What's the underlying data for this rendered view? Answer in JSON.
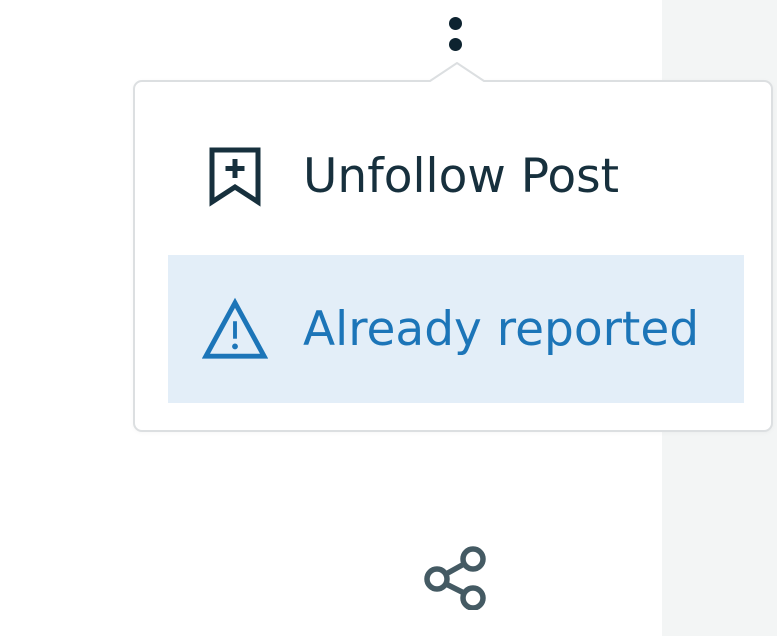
{
  "menu": {
    "items": [
      {
        "label": "Unfollow Post",
        "icon": "bookmark-plus-icon"
      },
      {
        "label": "Already reported",
        "icon": "warning-triangle-icon",
        "highlighted": true
      }
    ]
  },
  "colors": {
    "text_dark": "#17303d",
    "accent_blue": "#1c75b8",
    "highlight_bg": "#e3eef8",
    "panel_bg": "#f3f5f5",
    "border": "#dcdfe1"
  },
  "icons": {
    "more": "more-vertical-icon",
    "share": "share-icon"
  }
}
